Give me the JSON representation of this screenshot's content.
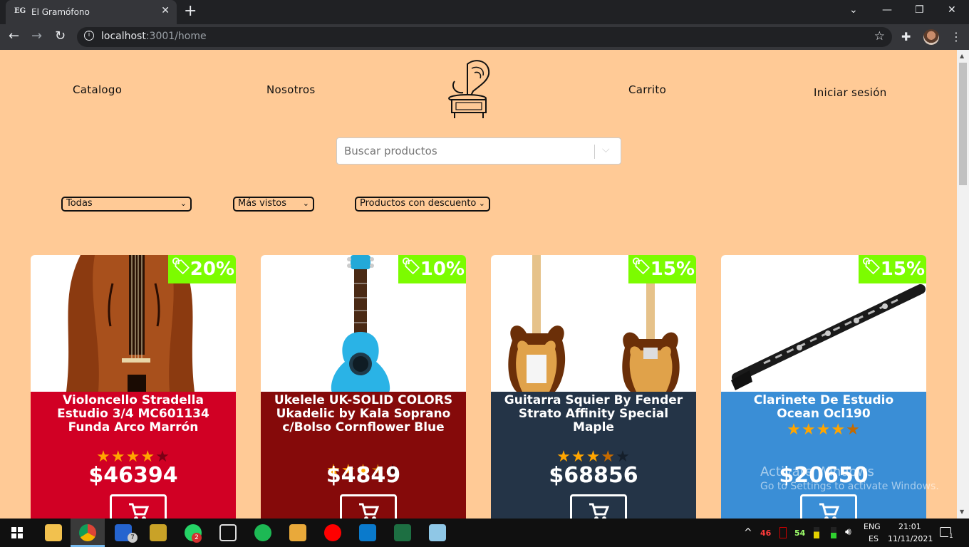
{
  "browser": {
    "tab_favicon": "EG",
    "tab_title": "El Gramófono",
    "tab_close": "✕",
    "new_tab": "+",
    "url_host": "localhost",
    "url_path": ":3001/home",
    "window_controls": [
      "⌄",
      "—",
      "❐",
      "✕"
    ]
  },
  "header": {
    "nav_catalog": "Catalogo",
    "nav_about": "Nosotros",
    "nav_cart": "Carrito",
    "nav_login": "Iniciar sesión",
    "logo": "gramophone-logo"
  },
  "search": {
    "placeholder": "Buscar productos"
  },
  "filters": {
    "category": "Todas",
    "sort": "Más vistos",
    "discount": "Productos con descuento"
  },
  "products": [
    {
      "name": "Violoncello Stradella Estudio 3/4 MC601134 Funda Arco Marrón",
      "discount": "20%",
      "price": "$46394",
      "rating": 4,
      "max_rating": 5,
      "color": "#d10024",
      "image": "cello"
    },
    {
      "name": "Ukelele UK-SOLID COLORS Ukadelic by Kala Soprano c/Bolso Cornflower Blue",
      "discount": "10%",
      "price": "$4849",
      "rating": 3.5,
      "max_rating": 5,
      "color": "#850a0a",
      "image": "ukulele"
    },
    {
      "name": "Guitarra Squier By Fender Strato Affinity Special Maple",
      "discount": "15%",
      "price": "$68856",
      "rating": 3.5,
      "max_rating": 5,
      "color": "#243447",
      "image": "electric-guitar"
    },
    {
      "name": "Clarinete De Estudio Ocean Ocl190",
      "discount": "15%",
      "price": "$20650",
      "rating": 4.5,
      "max_rating": 5,
      "color": "#3a8ed6",
      "image": "clarinet"
    }
  ],
  "watermark": {
    "line1": "Activate Windows",
    "line2": "Go to Settings to activate Windows."
  },
  "taskbar": {
    "badge_tasks": "7",
    "badge_whatsapp": "2",
    "tray_red_value": "46",
    "tray_green_value": "54",
    "lang_top": "ENG",
    "lang_bottom": "ES",
    "time": "21:01",
    "date": "11/11/2021",
    "notification_count": "1"
  },
  "colors": {
    "page_bg": "#ffca96",
    "badge_bg": "#7cfc00",
    "star": "#ffa500"
  }
}
